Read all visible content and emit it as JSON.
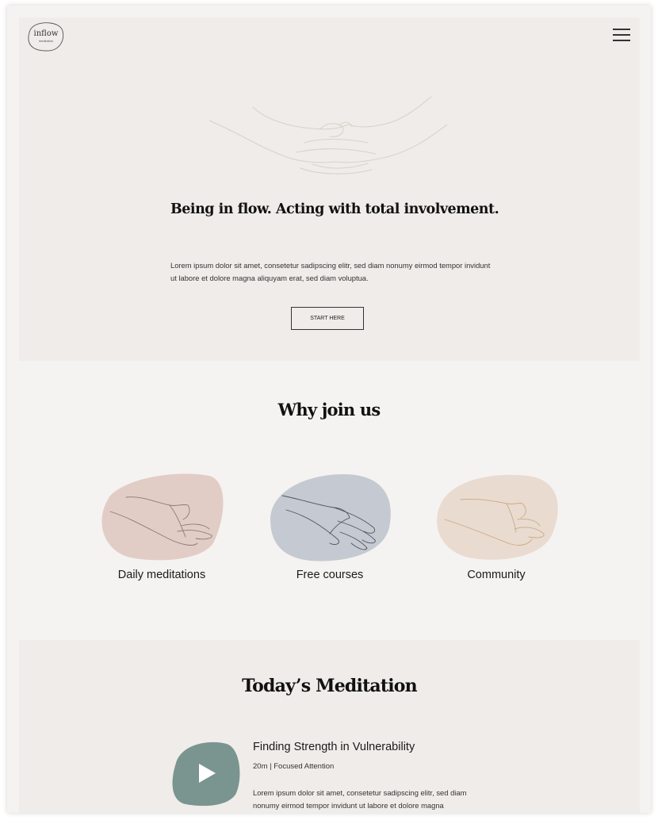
{
  "brand": {
    "name": "inflow",
    "tagline": "meditation"
  },
  "nav": {
    "menu_icon": "hamburger-menu-icon"
  },
  "hero": {
    "title": "Being in flow. Acting with total involvement.",
    "text": "Lorem ipsum dolor sit amet, consetetur sadipscing elitr, sed diam nonumy eirmod tempor invidunt ut labore et dolore magna aliquyam erat, sed diam voluptua.",
    "cta_label": "START HERE",
    "illustration": "meditating-hands-illustration"
  },
  "why": {
    "title": "Why join us",
    "features": [
      {
        "label": "Daily meditations",
        "icon": "open-hand-icon",
        "color": "#e2cdc6"
      },
      {
        "label": "Free courses",
        "icon": "mudra-hand-icon",
        "color": "#c5c9d1"
      },
      {
        "label": "Community",
        "icon": "gesture-hand-icon",
        "color": "#eadbd0"
      }
    ]
  },
  "today": {
    "title": "Today’s Meditation",
    "play_icon": "play-icon",
    "play_color": "#7a9590",
    "item_title": "Finding Strength in Vulnerability",
    "meta": "20m | Focused Attention",
    "description": "Lorem ipsum dolor sit amet, consetetur sadipscing elitr, sed diam nonumy eirmod tempor invidunt ut labore et dolore magna"
  },
  "colors": {
    "page_bg": "#f5f3f1",
    "section_bg": "#f0ece9",
    "text": "#1a1a1a"
  }
}
